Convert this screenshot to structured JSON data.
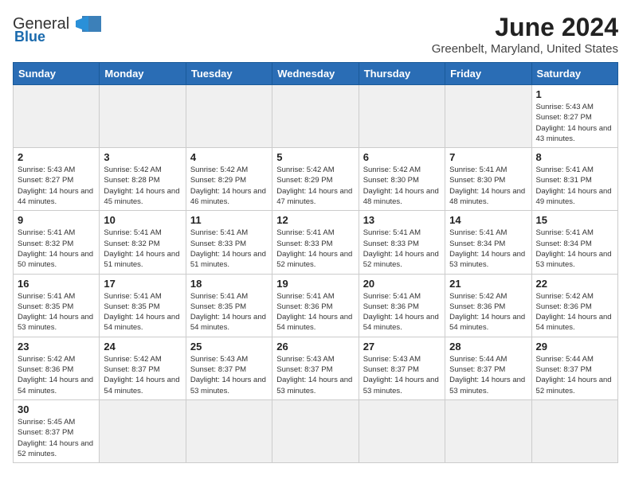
{
  "header": {
    "logo_line1": "General",
    "logo_line2": "Blue",
    "title": "June 2024",
    "subtitle": "Greenbelt, Maryland, United States"
  },
  "weekdays": [
    "Sunday",
    "Monday",
    "Tuesday",
    "Wednesday",
    "Thursday",
    "Friday",
    "Saturday"
  ],
  "days": [
    {
      "num": "",
      "sunrise": "",
      "sunset": "",
      "daylight": "",
      "empty": true
    },
    {
      "num": "",
      "sunrise": "",
      "sunset": "",
      "daylight": "",
      "empty": true
    },
    {
      "num": "",
      "sunrise": "",
      "sunset": "",
      "daylight": "",
      "empty": true
    },
    {
      "num": "",
      "sunrise": "",
      "sunset": "",
      "daylight": "",
      "empty": true
    },
    {
      "num": "",
      "sunrise": "",
      "sunset": "",
      "daylight": "",
      "empty": true
    },
    {
      "num": "",
      "sunrise": "",
      "sunset": "",
      "daylight": "",
      "empty": true
    },
    {
      "num": "1",
      "sunrise": "Sunrise: 5:43 AM",
      "sunset": "Sunset: 8:27 PM",
      "daylight": "Daylight: 14 hours and 43 minutes.",
      "empty": false
    },
    {
      "num": "2",
      "sunrise": "Sunrise: 5:43 AM",
      "sunset": "Sunset: 8:27 PM",
      "daylight": "Daylight: 14 hours and 44 minutes.",
      "empty": false
    },
    {
      "num": "3",
      "sunrise": "Sunrise: 5:42 AM",
      "sunset": "Sunset: 8:28 PM",
      "daylight": "Daylight: 14 hours and 45 minutes.",
      "empty": false
    },
    {
      "num": "4",
      "sunrise": "Sunrise: 5:42 AM",
      "sunset": "Sunset: 8:29 PM",
      "daylight": "Daylight: 14 hours and 46 minutes.",
      "empty": false
    },
    {
      "num": "5",
      "sunrise": "Sunrise: 5:42 AM",
      "sunset": "Sunset: 8:29 PM",
      "daylight": "Daylight: 14 hours and 47 minutes.",
      "empty": false
    },
    {
      "num": "6",
      "sunrise": "Sunrise: 5:42 AM",
      "sunset": "Sunset: 8:30 PM",
      "daylight": "Daylight: 14 hours and 48 minutes.",
      "empty": false
    },
    {
      "num": "7",
      "sunrise": "Sunrise: 5:41 AM",
      "sunset": "Sunset: 8:30 PM",
      "daylight": "Daylight: 14 hours and 48 minutes.",
      "empty": false
    },
    {
      "num": "8",
      "sunrise": "Sunrise: 5:41 AM",
      "sunset": "Sunset: 8:31 PM",
      "daylight": "Daylight: 14 hours and 49 minutes.",
      "empty": false
    },
    {
      "num": "9",
      "sunrise": "Sunrise: 5:41 AM",
      "sunset": "Sunset: 8:32 PM",
      "daylight": "Daylight: 14 hours and 50 minutes.",
      "empty": false
    },
    {
      "num": "10",
      "sunrise": "Sunrise: 5:41 AM",
      "sunset": "Sunset: 8:32 PM",
      "daylight": "Daylight: 14 hours and 51 minutes.",
      "empty": false
    },
    {
      "num": "11",
      "sunrise": "Sunrise: 5:41 AM",
      "sunset": "Sunset: 8:33 PM",
      "daylight": "Daylight: 14 hours and 51 minutes.",
      "empty": false
    },
    {
      "num": "12",
      "sunrise": "Sunrise: 5:41 AM",
      "sunset": "Sunset: 8:33 PM",
      "daylight": "Daylight: 14 hours and 52 minutes.",
      "empty": false
    },
    {
      "num": "13",
      "sunrise": "Sunrise: 5:41 AM",
      "sunset": "Sunset: 8:33 PM",
      "daylight": "Daylight: 14 hours and 52 minutes.",
      "empty": false
    },
    {
      "num": "14",
      "sunrise": "Sunrise: 5:41 AM",
      "sunset": "Sunset: 8:34 PM",
      "daylight": "Daylight: 14 hours and 53 minutes.",
      "empty": false
    },
    {
      "num": "15",
      "sunrise": "Sunrise: 5:41 AM",
      "sunset": "Sunset: 8:34 PM",
      "daylight": "Daylight: 14 hours and 53 minutes.",
      "empty": false
    },
    {
      "num": "16",
      "sunrise": "Sunrise: 5:41 AM",
      "sunset": "Sunset: 8:35 PM",
      "daylight": "Daylight: 14 hours and 53 minutes.",
      "empty": false
    },
    {
      "num": "17",
      "sunrise": "Sunrise: 5:41 AM",
      "sunset": "Sunset: 8:35 PM",
      "daylight": "Daylight: 14 hours and 54 minutes.",
      "empty": false
    },
    {
      "num": "18",
      "sunrise": "Sunrise: 5:41 AM",
      "sunset": "Sunset: 8:35 PM",
      "daylight": "Daylight: 14 hours and 54 minutes.",
      "empty": false
    },
    {
      "num": "19",
      "sunrise": "Sunrise: 5:41 AM",
      "sunset": "Sunset: 8:36 PM",
      "daylight": "Daylight: 14 hours and 54 minutes.",
      "empty": false
    },
    {
      "num": "20",
      "sunrise": "Sunrise: 5:41 AM",
      "sunset": "Sunset: 8:36 PM",
      "daylight": "Daylight: 14 hours and 54 minutes.",
      "empty": false
    },
    {
      "num": "21",
      "sunrise": "Sunrise: 5:42 AM",
      "sunset": "Sunset: 8:36 PM",
      "daylight": "Daylight: 14 hours and 54 minutes.",
      "empty": false
    },
    {
      "num": "22",
      "sunrise": "Sunrise: 5:42 AM",
      "sunset": "Sunset: 8:36 PM",
      "daylight": "Daylight: 14 hours and 54 minutes.",
      "empty": false
    },
    {
      "num": "23",
      "sunrise": "Sunrise: 5:42 AM",
      "sunset": "Sunset: 8:36 PM",
      "daylight": "Daylight: 14 hours and 54 minutes.",
      "empty": false
    },
    {
      "num": "24",
      "sunrise": "Sunrise: 5:42 AM",
      "sunset": "Sunset: 8:37 PM",
      "daylight": "Daylight: 14 hours and 54 minutes.",
      "empty": false
    },
    {
      "num": "25",
      "sunrise": "Sunrise: 5:43 AM",
      "sunset": "Sunset: 8:37 PM",
      "daylight": "Daylight: 14 hours and 53 minutes.",
      "empty": false
    },
    {
      "num": "26",
      "sunrise": "Sunrise: 5:43 AM",
      "sunset": "Sunset: 8:37 PM",
      "daylight": "Daylight: 14 hours and 53 minutes.",
      "empty": false
    },
    {
      "num": "27",
      "sunrise": "Sunrise: 5:43 AM",
      "sunset": "Sunset: 8:37 PM",
      "daylight": "Daylight: 14 hours and 53 minutes.",
      "empty": false
    },
    {
      "num": "28",
      "sunrise": "Sunrise: 5:44 AM",
      "sunset": "Sunset: 8:37 PM",
      "daylight": "Daylight: 14 hours and 53 minutes.",
      "empty": false
    },
    {
      "num": "29",
      "sunrise": "Sunrise: 5:44 AM",
      "sunset": "Sunset: 8:37 PM",
      "daylight": "Daylight: 14 hours and 52 minutes.",
      "empty": false
    },
    {
      "num": "30",
      "sunrise": "Sunrise: 5:45 AM",
      "sunset": "Sunset: 8:37 PM",
      "daylight": "Daylight: 14 hours and 52 minutes.",
      "empty": false
    }
  ]
}
